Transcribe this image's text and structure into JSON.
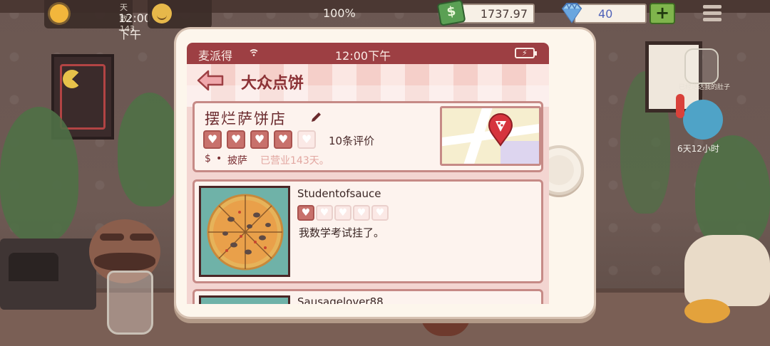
{
  "hud": {
    "weather_day": "天数：143",
    "time": "12:00下午",
    "mood_percent": "100%",
    "money": "1737.97",
    "gems": "40",
    "add_label": "+"
  },
  "phone": {
    "status": {
      "carrier": "麦派得",
      "clock": "12:00下午"
    },
    "app_title": "大众点饼",
    "business": {
      "name": "摆烂萨饼店",
      "rating_filled": 4,
      "rating_max": 5,
      "review_count": "10条评价",
      "price": "$",
      "separator": "•",
      "category": "披萨",
      "open_days": "已营业143天。"
    },
    "reviews": [
      {
        "reviewer": "Studentofsauce",
        "rating_filled": 1,
        "rating_max": 5,
        "text": "我数学考试挂了。"
      },
      {
        "reviewer": "Sausagelover88"
      }
    ]
  },
  "background": {
    "right_timer": "6天12小时",
    "right_jar_label": "已经送达我的肚子"
  },
  "colors": {
    "status_bar": "#9d3f43",
    "heart_filled": "#c8716c",
    "heart_empty": "#fbe9e6",
    "money_icon": "#5aa054",
    "gem_text": "#5063b9",
    "plus_button": "#7fb54c"
  }
}
